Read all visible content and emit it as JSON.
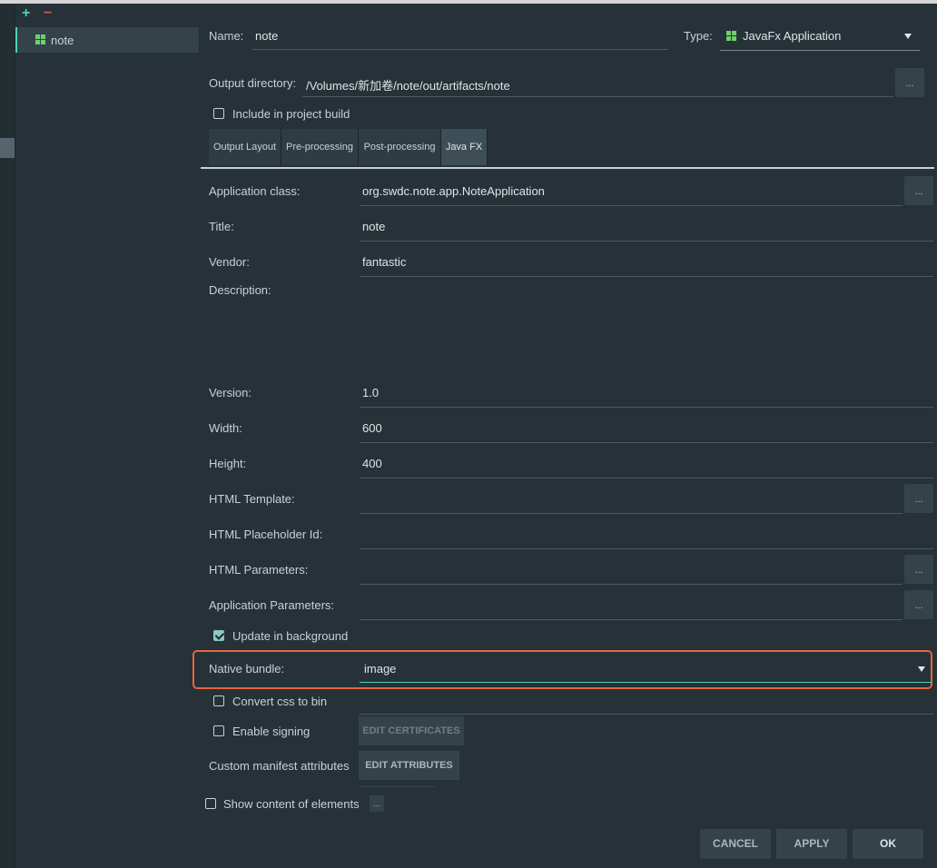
{
  "toolbar": {
    "add_symbol": "+",
    "remove_symbol": "−"
  },
  "tree": {
    "items": [
      {
        "label": "note",
        "icon": "javafx-artifact-icon"
      }
    ]
  },
  "artifact": {
    "name_label": "Name:",
    "name_value": "note",
    "type_label": "Type:",
    "type_value": "JavaFx Application",
    "output_dir_label": "Output directory:",
    "output_dir_value": "/Volumes/新加卷/note/out/artifacts/note",
    "browse_label": "...",
    "include_build_label": "Include in project build"
  },
  "tabs": [
    {
      "label": "Output Layout"
    },
    {
      "label": "Pre-processing"
    },
    {
      "label": "Post-processing"
    },
    {
      "label": "Java FX"
    }
  ],
  "javafx": {
    "app_class_label": "Application class:",
    "app_class_value": "org.swdc.note.app.NoteApplication",
    "title_label": "Title:",
    "title_value": "note",
    "vendor_label": "Vendor:",
    "vendor_value": "fantastic",
    "description_label": "Description:",
    "version_label": "Version:",
    "version_value": "1.0",
    "width_label": "Width:",
    "width_value": "600",
    "height_label": "Height:",
    "height_value": "400",
    "html_template_label": "HTML Template:",
    "html_placeholder_label": "HTML Placeholder Id:",
    "html_params_label": "HTML Parameters:",
    "app_params_label": "Application Parameters:",
    "update_bg_label": "Update in background",
    "native_bundle_label": "Native bundle:",
    "native_bundle_value": "image",
    "convert_css_label": "Convert css to bin",
    "enable_signing_label": "Enable signing",
    "edit_certs_label": "EDIT CERTIFICATES",
    "manifest_label": "Custom manifest attributes",
    "edit_attrs_label": "EDIT  ATTRIBUTES",
    "show_content_label": "Show content of elements"
  },
  "dialog": {
    "cancel": "CANCEL",
    "apply": "APPLY",
    "ok": "OK"
  },
  "colors": {
    "accent": "#4fd0b6",
    "highlight": "#e8643a",
    "background": "#263238"
  }
}
